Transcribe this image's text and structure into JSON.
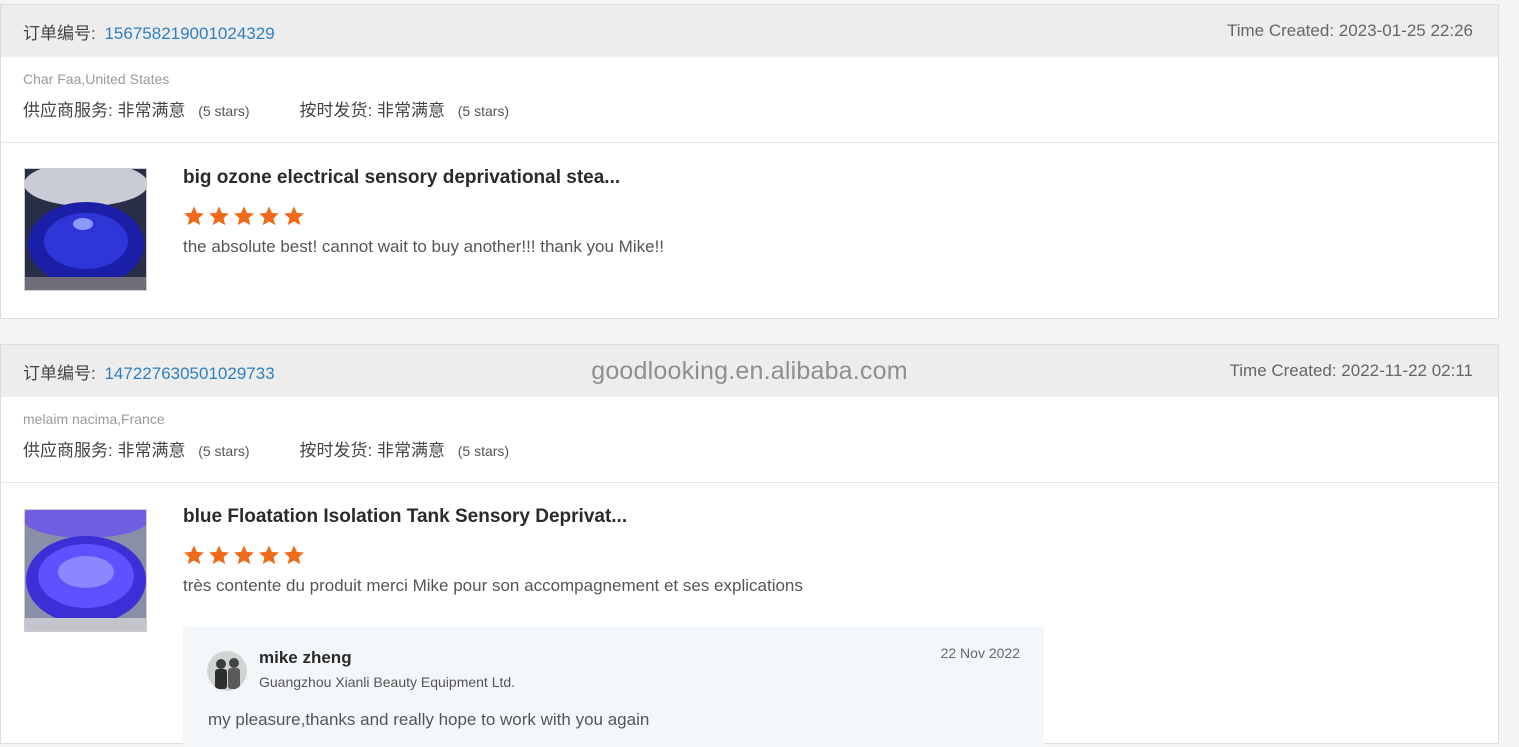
{
  "watermark": "goodlooking.en.alibaba.com",
  "orders": [
    {
      "order_no_label": "订单编号:",
      "order_no": "156758219001024329",
      "time_created": "Time Created: 2023-01-25 22:26",
      "buyer": "Char Faa,United States",
      "ratings": [
        {
          "label": "供应商服务:",
          "value": "非常满意",
          "note": "(5 stars)"
        },
        {
          "label": "按时发货:",
          "value": "非常满意",
          "note": "(5 stars)"
        }
      ],
      "product_title": "big ozone electrical sensory deprivational stea...",
      "stars": 5,
      "comment": "the absolute best! cannot wait to buy another!!! thank you Mike!!"
    },
    {
      "order_no_label": "订单编号:",
      "order_no": "147227630501029733",
      "time_created": "Time Created: 2022-11-22 02:11",
      "buyer": "melaim nacima,France",
      "ratings": [
        {
          "label": "供应商服务:",
          "value": "非常满意",
          "note": "(5 stars)"
        },
        {
          "label": "按时发货:",
          "value": "非常满意",
          "note": "(5 stars)"
        }
      ],
      "product_title": "blue Floatation Isolation Tank Sensory Deprivat...",
      "stars": 5,
      "comment": "très contente du produit merci Mike pour son accompagnement et ses explications",
      "reply": {
        "name": "mike zheng",
        "company": "Guangzhou Xianli Beauty Equipment Ltd.",
        "date": "22 Nov 2022",
        "text": "my pleasure,thanks and really hope to work with you again"
      }
    }
  ],
  "colors": {
    "star": "#f06a1b",
    "order_no": "#2f7fc1"
  }
}
